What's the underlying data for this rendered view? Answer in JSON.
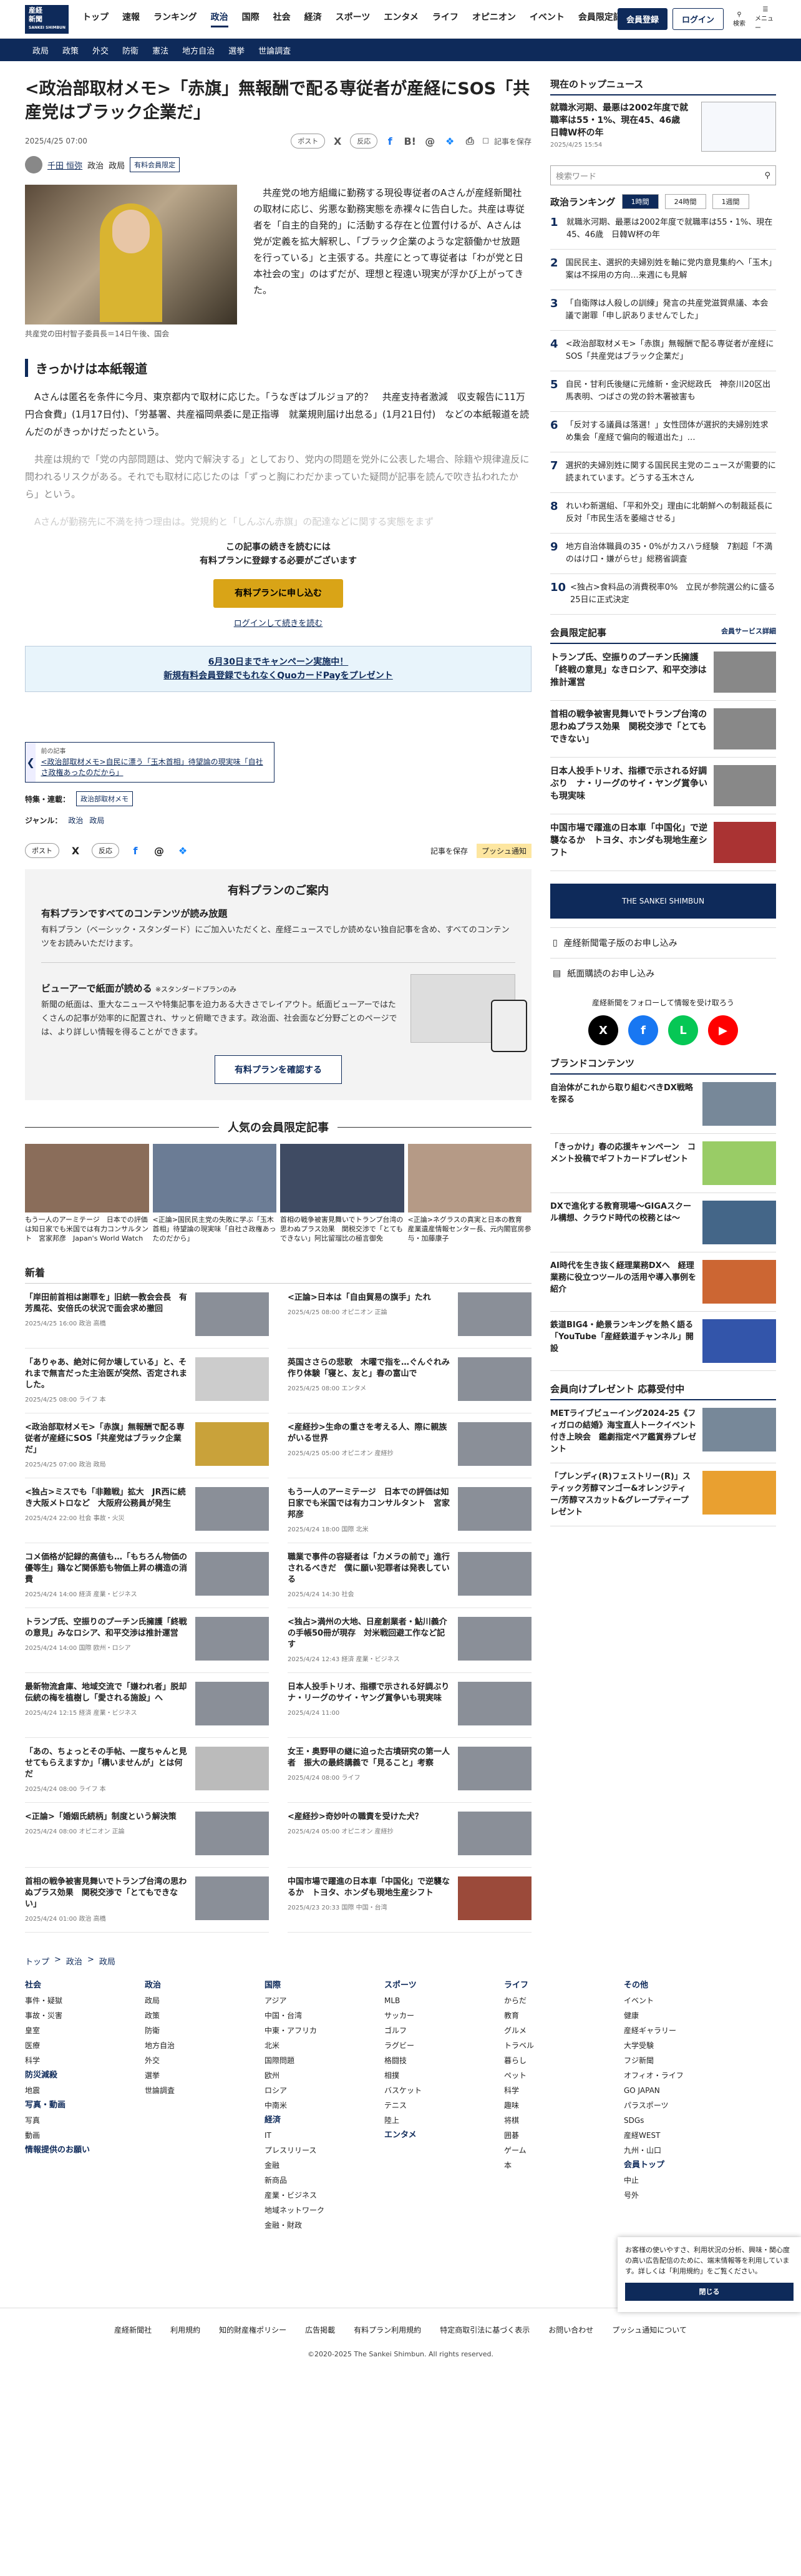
{
  "header": {
    "logo": [
      "産経",
      "新聞",
      "SANKEI SHIMBUN"
    ],
    "nav": [
      "トップ",
      "速報",
      "ランキング",
      "政治",
      "国際",
      "社会",
      "経済",
      "スポーツ",
      "エンタメ",
      "ライフ",
      "オピニオン",
      "イベント",
      "会員限定記事"
    ],
    "register": "会員登録",
    "login": "ログイン",
    "search": "検索",
    "menu": "メニュー"
  },
  "subnav": [
    "政局",
    "政策",
    "外交",
    "防衛",
    "憲法",
    "地方自治",
    "選挙",
    "世論調査"
  ],
  "article": {
    "title": "<政治部取材メモ>「赤旗」無報酬で配る専従者が産経にSOS「共産党はブラック企業だ」",
    "date": "2025/4/25 07:00",
    "post": "ポスト",
    "cite": "反応",
    "save": "記事を保存",
    "author": "千田 恒弥",
    "author_tags": [
      "政治",
      "政局"
    ],
    "member_tag": "有料会員限定",
    "caption": "共産党の田村智子委員長＝14日午後、国会",
    "lead": "共産党の地方組織に勤務する現役専従者のAさんが産経新聞社の取材に応じ、劣悪な勤務実態を赤裸々に告白した。共産は専従者を「自主的自発的」に活動する存在と位置付けるが、Aさんは党が定義を拡大解釈し、「ブラック企業のような定額働かせ放題を行っている」と主張する。共産にとって専従者は「わが党と日本社会の宝」のはずだが、理想と程遠い現実が浮かび上がってきた。",
    "h2": "きっかけは本紙報道",
    "p1": "Aさんは匿名を条件に今月、東京都内で取材に応じた。「うなぎはブルジョア的？　共産支持者激減　収支報告に11万円合食費」(1月17日付)、「労基署、共産福岡県委に是正指導　就業規則届け出怠る」(1月21日付)　などの本紙報道を読んだのがきっかけだったという。",
    "p2": "共産は規約で「党の内部問題は、党内で解決する」としており、党内の問題を党外に公表した場合、除籍や規律違反に問われるリスクがある。それでも取材に応じたのは「ずっと胸にわだかまっていた疑問が記事を読んで吹き払われたから」という。",
    "p3": "Aさんが勤務先に不満を持つ理由は。党規約と「しんぶん赤旗」の配達などに関する実態をまず",
    "pw1": "この記事の続きを読むには",
    "pw2": "有料プランに登録する必要がございます",
    "pbtn": "有料プランに申し込む",
    "plink": "ログインして続きを読む",
    "campaign1": "6月30日までキャンペーン実施中！",
    "campaign2": "新規有料会員登録でもれなくQuoカードPayをプレゼント",
    "prev_label": "前の記事",
    "prev_title": "<政治部取材メモ>自民に漂う「玉木首相」待望論の現実味「自社さ政権あったのだから」",
    "topic_label": "特集・連載：",
    "topic": "政治部取材メモ",
    "genre_label": "ジャンル：",
    "genre": [
      "政治",
      "政局"
    ],
    "push": "プッシュ通知"
  },
  "plan": {
    "title": "有料プランのご案内",
    "h1": "有料プランですべてのコンテンツが読み放題",
    "p1": "有料プラン（ベーシック・スタンダード）にご加入いただくと、産経ニュースでしか読めない独自記事を含め、すべてのコンテンツをお読みいただけます。",
    "h2": "ビューアーで紙面が読める",
    "h2sub": "※スタンダードプランのみ",
    "p2": "新聞の紙面は、重大なニュースや特集記事を迫力ある大きさでレイアウト。紙面ビューアーではたくさんの記事が効率的に配置され、サッと俯瞰できます。政治面、社会面など分野ごとのページでは、より詳しい情報を得ることができます。",
    "btn": "有料プランを確認する"
  },
  "popular": {
    "title": "人気の会員限定記事",
    "items": [
      "もう一人のアーミテージ　日本での評価は知日家でも米国では有力コンサルタント　宮家邦彦　Japan's World Watch",
      "<正論>国民民主党の失敗に学ぶ「玉木首相」待望論の現実味「自社さ政権あったのだから」",
      "首相の戦争被害見舞いでトランプ台湾の思わぬプラス効果　関税交渉で「とてもできない」阿比留瑠比の極言御免",
      "<正論>ネグラスの真実と日本の教育　産業遺産情報センター長、元内閣官房参与・加藤康子"
    ]
  },
  "latest": {
    "title": "新着",
    "items": [
      {
        "t": "「岸田前首相は謝罪を」旧統一教会会長　有芳風花、安倍氏の状況で面会求め撤回",
        "m": "2025/4/25 16:00 政治 高橋"
      },
      {
        "t": "<正論>日本は「自由貿易の旗手」たれ",
        "m": "2025/4/25 08:00 オピニオン 正論"
      },
      {
        "t": "「ありゃあ、絶対に何か壊している」と、それまで無言だった主治医が突然、否定されました。",
        "m": "2025/4/25 08:00 ライフ 本"
      },
      {
        "t": "英国ささらの悲歌　木曜で指を…ぐんぐれみ作り体験「寝と、友と」春の富山で",
        "m": "2025/4/25 08:00 エンタメ"
      },
      {
        "t": "<政治部取材メモ>「赤旗」無報酬で配る専従者が産経にSOS「共産党はブラック企業だ」",
        "m": "2025/4/25 07:00 政治 政局"
      },
      {
        "t": "<産経抄>生命の重さを考える人、際に親族がいる世界",
        "m": "2025/4/25 05:00 オピニオン 産経抄"
      },
      {
        "t": "<独占>ミスでも「非難戦」拡大　JR西に続き大阪メトロなど　大阪府公務員が発生",
        "m": "2025/4/24 22:00 社会 事故・火災"
      },
      {
        "t": "もう一人のアーミテージ　日本での評価は知日家でも米国では有力コンサルタント　宮家邦彦",
        "m": "2025/4/24 18:00 国際 北米"
      },
      {
        "t": "コメ価格が記録的高値も…「もちろん物価の優等生」鶏など関係筋も物価上昇の構造の消費",
        "m": "2025/4/24 14:00 経済 産業・ビジネス"
      },
      {
        "t": "職業で事件の容疑者は「カメラの前で」進行されるべきだ　僕に願い犯罪者は発表している",
        "m": "2025/4/24 14:30 社会"
      },
      {
        "t": "トランプ氏、空振りのプーチン氏擁護「終戦の意見」みなロシア、和平交渉は推計運営",
        "m": "2025/4/24 14:00 国際 欧州・ロシア"
      },
      {
        "t": "<独占>満州の大地、日産創業者・鮎川義介の手帳50冊が現存　対米戦回避工作など記す",
        "m": "2025/4/24 12:43 経済 産業・ビジネス"
      },
      {
        "t": "最新物流倉庫、地域交流で「嫌われ者」脱却　伝統の梅を植樹し「愛される施設」へ",
        "m": "2025/4/24 12:15 経済 産業・ビジネス"
      },
      {
        "t": "日本人投手トリオ、指標で示される好調ぶり　ナ・リーグのサイ・ヤング賞争いも現実味",
        "m": "2025/4/24 11:00"
      },
      {
        "t": "「あの、ちょっとその手帖、一度ちゃんと見せてもらえますか」「構いませんが」とは何だ",
        "m": "2025/4/24 08:00 ライフ 本"
      },
      {
        "t": "女王・奥野甲の継に迫った古墳研究の第一人者　振大の最終講義で「見ること」考察",
        "m": "2025/4/24 08:00 ライフ"
      },
      {
        "t": "<正論>「婚姻氏続柄」制度という解決策",
        "m": "2025/4/24 08:00 オピニオン 正論"
      },
      {
        "t": "<産経抄>奇妙叶の職責を受けた犬？",
        "m": "2025/4/24 05:00 オピニオン 産経抄"
      },
      {
        "t": "首相の戦争被害見舞いでトランプ台湾の思わぬプラス効果　関税交渉で「とてもできない」",
        "m": "2025/4/24 01:00 政治 高橋"
      },
      {
        "t": "中国市場で躍進の日本車「中国化」で逆襲なるか　トヨタ、ホンダも現地生産シフト",
        "m": "2025/4/23 20:33 国際 中国・台湾"
      }
    ]
  },
  "breadcrumb": [
    "トップ",
    "政治",
    "政局"
  ],
  "footer": {
    "cols": [
      {
        "h": "社会",
        "items": [
          "事件・疑獄",
          "事故・災害",
          "皇室",
          "医療",
          "科学",
          "防災減殺",
          "地震",
          "写真・動画",
          "写真",
          "動画",
          "情報提供のお願い"
        ]
      },
      {
        "h": "政治",
        "items": [
          "政局",
          "政策",
          "防衛",
          "地方自治",
          "外交",
          "選挙",
          "世論調査"
        ]
      },
      {
        "h": "国際",
        "items": [
          "アジア",
          "中国・台湾",
          "中東・アフリカ",
          "北米",
          "国際問題",
          "欧州",
          "ロシア",
          "中南米",
          "経済",
          "IT",
          "プレスリリース",
          "金融",
          "新商品",
          "産業・ビジネス",
          "地域ネットワーク",
          "金融・財政"
        ]
      },
      {
        "h": "スポーツ",
        "items": [
          "MLB",
          "サッカー",
          "ゴルフ",
          "ラグビー",
          "格闘技",
          "相撲",
          "バスケット",
          "テニス",
          "陸上",
          "エンタメ"
        ]
      },
      {
        "h": "ライフ",
        "items": [
          "からだ",
          "教育",
          "グルメ",
          "トラベル",
          "暮らし",
          "ペット",
          "科学",
          "趣味",
          "将棋",
          "囲碁",
          "ゲーム",
          "本"
        ]
      },
      {
        "h": "その他",
        "items": [
          "イベント",
          "健康",
          "産経ギャラリー",
          "大学受験",
          "フジ新聞",
          "オフィオ・ライフ",
          "GO JAPAN",
          "パラスポーツ",
          "SDGs",
          "産経WEST",
          "九州・山口",
          "会員トップ",
          "中止",
          "号外"
        ]
      }
    ],
    "bottom": [
      "産経新聞社",
      "利用規約",
      "知的財産権ポリシー",
      "広告掲載",
      "有料プラン利用規約",
      "特定商取引法に基づく表示",
      "お問い合わせ",
      "プッシュ通知について"
    ],
    "copyright": "©2020-2025 The Sankei Shimbun. All rights reserved."
  },
  "cookie": {
    "text": "お客様の使いやすさ、利用状況の分析、興味・関心度の高い広告配信のために、端末情報等を利用しています。詳しくは「利用規約」をご覧ください。",
    "close": "閉じる"
  },
  "side": {
    "top_title": "現在のトップニュース",
    "top_headline": "就職氷河期、最悪は2002年度で就職率は55・1%、現在45、46歳　日韓W杯の年",
    "top_date": "2025/4/25 15:54",
    "search_placeholder": "検索ワード",
    "rank_title": "政治ランキング",
    "rank_tabs": [
      "1時間",
      "24時間",
      "1週間"
    ],
    "ranking": [
      "就職氷河期、最悪は2002年度で就職率は55・1%、現在45、46歳　日韓W杯の年",
      "国民民主、選択的夫婦別姓を軸に党内意見集約へ「玉木」案は不採用の方向…来週にも見解",
      "「自衛隊は人殺しの訓練」発言の共産党滋賀県議、本会議で謝罪「申し訳ありませんでした」",
      "<政治部取材メモ>「赤旗」無報酬で配る専従者が産経にSOS「共産党はブラック企業だ」",
      "自民・甘利氏後継に元維新・金沢総政氏　神奈川20区出馬表明、つばさの党の鈴木署被害も",
      "「反対する議員は落選！」女性団体が選択的夫婦別姓求め集会「産経で偏向的報道出た」…",
      "選択的夫婦別姓に関する国民民主党のニュースが需要的に読まれています。どうする玉木さん",
      "れいわ新選組、「平和外交」理由に北朝鮮への制裁延長に反対「市民生活を萎縮させる」",
      "地方自治体職員の35・0%がカスハラ経験　7割超「不満のはけ口・嫌がらせ」総務省調査",
      "<独占>食料品の消費税率0%　立民が参院選公約に盛る　25日に正式決定"
    ],
    "member_title": "会員限定記事",
    "member_service": "会員サービス詳細",
    "member": [
      "トランプ氏、空振りのプーチン氏擁護「終戦の意見」なきロシア、和平交渉は推計運営",
      "首相の戦争被害見舞いでトランプ台湾の思わぬプラス効果　関税交渉で「とてもできない」",
      "日本人投手トリオ、指標で示される好調ぶり　ナ・リーグのサイ・ヤング賞争いも現実味",
      "中国市場で躍進の日本車「中国化」で逆襲なるか　トヨタ、ホンダも現地生産シフト"
    ],
    "banner": "THE SANKEI SHIMBUN",
    "links": [
      "産経新聞電子版のお申し込み",
      "紙面購読のお申し込み"
    ],
    "follow": "産経新聞をフォローして情報を受け取ろう",
    "brand_title": "ブランドコンテンツ",
    "brand": [
      "自治体がこれから取り組むべきDX戦略を探る",
      "「きっかけ」春の応援キャンペーン　コメント投稿でギフトカードプレゼント",
      "DXで進化する教育現場～GIGAスクール構想、クラウド時代の校務とは～",
      "AI時代を生き抜く経理業務DXへ　経理業務に役立つツールの活用や導入事例を紹介",
      "鉄道BIG4・絶景ランキングを熱く語る「YouTube「産経鉄道チャンネル」開設"
    ],
    "present_title": "会員向けプレゼント 応募受付中",
    "present": [
      "METライブビューイング2024-25《フィガロの結婚》海宝直人トークイベント付き上映会　鑑劇指定ペア鑑賞券プレゼント",
      "「プレンディ(R)フェストリー(R)」スティック芳醇マンゴー&オレンジティー/芳醇マスカット&グレープティープレゼント"
    ]
  }
}
